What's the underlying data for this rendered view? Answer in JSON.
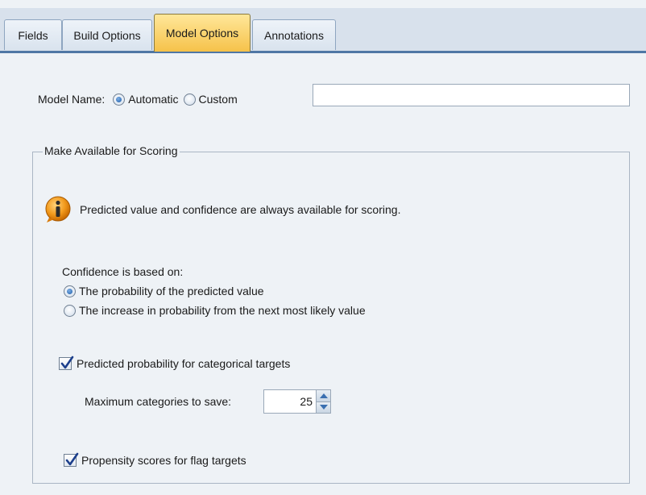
{
  "tabs": [
    {
      "label": "Fields",
      "active": false
    },
    {
      "label": "Build Options",
      "active": false
    },
    {
      "label": "Model Options",
      "active": true
    },
    {
      "label": "Annotations",
      "active": false
    }
  ],
  "model_name": {
    "label": "Model Name:",
    "automatic_label": "Automatic",
    "custom_label": "Custom",
    "selected": "Automatic",
    "custom_value": ""
  },
  "scoring": {
    "group_title": "Make Available for Scoring",
    "info_icon": "info-icon",
    "info_text": "Predicted value and confidence are always available for scoring.",
    "confidence_label": "Confidence is based on:",
    "confidence_options": [
      {
        "label": "The probability of the predicted value",
        "selected": true
      },
      {
        "label": "The increase in probability from the next most likely value",
        "selected": false
      }
    ],
    "predicted_probability": {
      "label": "Predicted probability for categorical targets",
      "checked": true
    },
    "max_categories_label": "Maximum categories to save:",
    "max_categories_value": "25",
    "propensity": {
      "label": "Propensity scores for flag targets",
      "checked": true
    }
  },
  "colors": {
    "accent": "#1c5ca8",
    "active_tab": "#f6c24a",
    "tab_underline": "#4f77a5",
    "background": "#eef2f6"
  }
}
